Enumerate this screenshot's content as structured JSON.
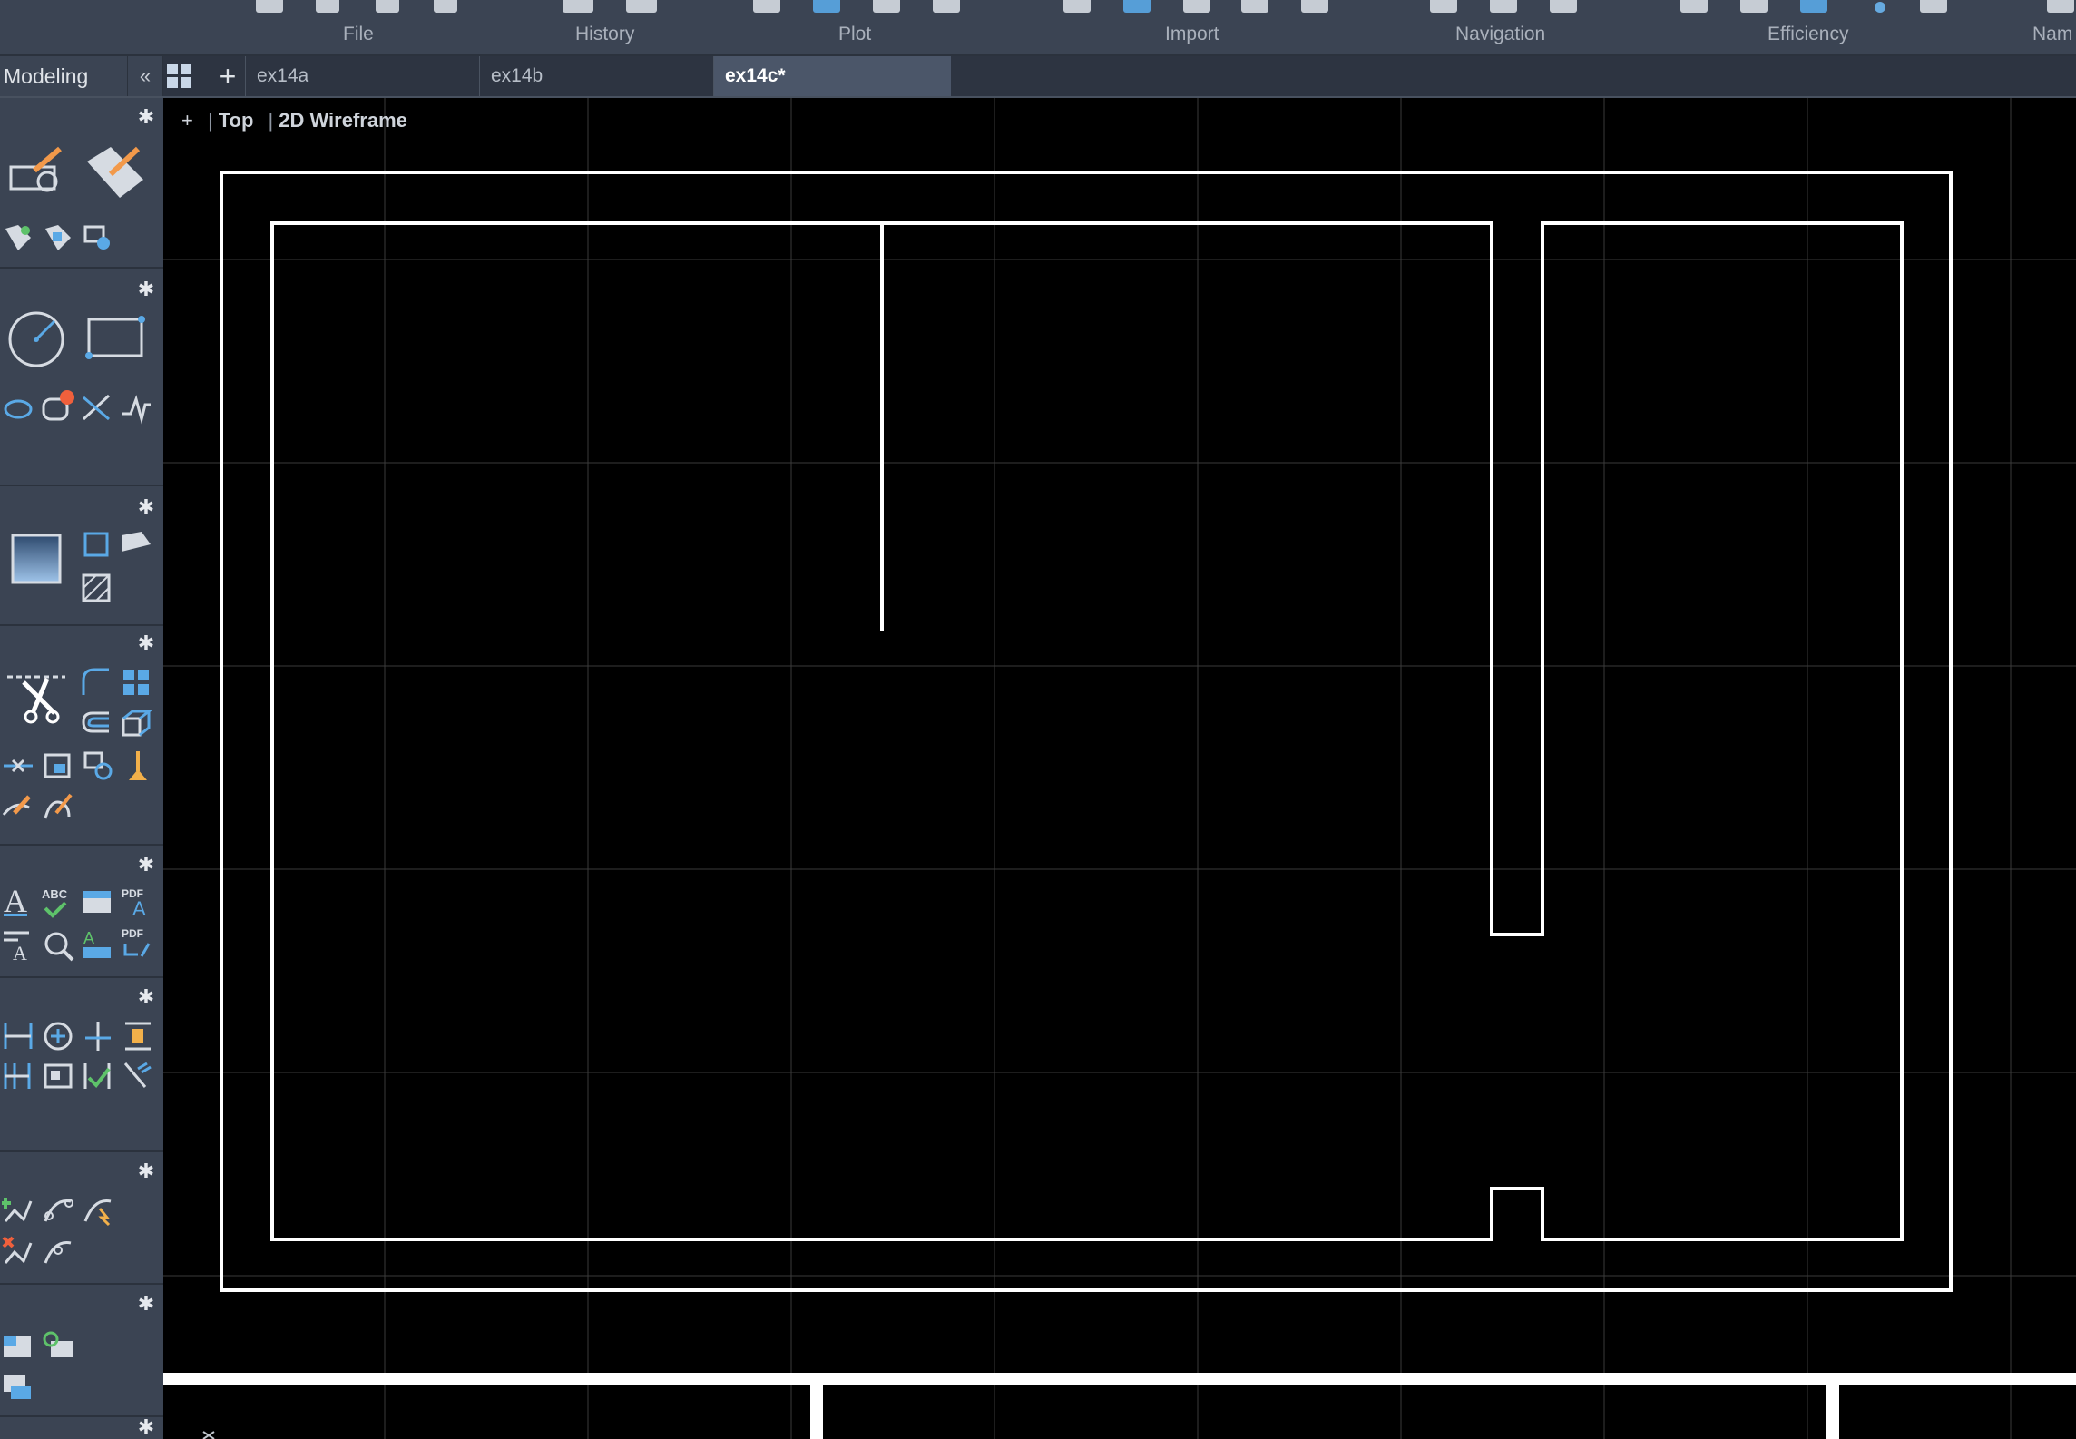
{
  "ribbon": {
    "groups": [
      {
        "label": "File"
      },
      {
        "label": "History"
      },
      {
        "label": "Plot"
      },
      {
        "label": "Import"
      },
      {
        "label": "Navigation"
      },
      {
        "label": "Efficiency"
      },
      {
        "label": "Nam"
      }
    ]
  },
  "tabbar": {
    "workspace": "Modeling",
    "collapse": "«",
    "new_tab": "+",
    "tabs": [
      {
        "label": "ex14a"
      },
      {
        "label": "ex14b"
      },
      {
        "label": "ex14c*"
      }
    ]
  },
  "viewport": {
    "plus": "+",
    "view": "Top",
    "style": "2D Wireframe"
  },
  "palette": {
    "gear": "✱",
    "labels": {
      "abc": "ABC",
      "pdf": "PDF",
      "text_a": "A"
    }
  },
  "colors": {
    "ribbon_bg": "#3b4453",
    "canvas_bg": "#000000",
    "grid": "#3a3a3a",
    "geometry": "#ffffff",
    "accent": "#5aa9e6",
    "active_tab": "#4b5669"
  },
  "icons": [
    "settings-gear-icon",
    "line-edit-icon",
    "circle-icon",
    "rectangle-icon",
    "ellipse-icon",
    "revision-cloud-icon",
    "hatch-icon",
    "trim-icon",
    "fillet-icon",
    "array-icon",
    "offset-icon",
    "text-icon",
    "spell-check-icon",
    "dimension-icon",
    "layer-icon"
  ]
}
